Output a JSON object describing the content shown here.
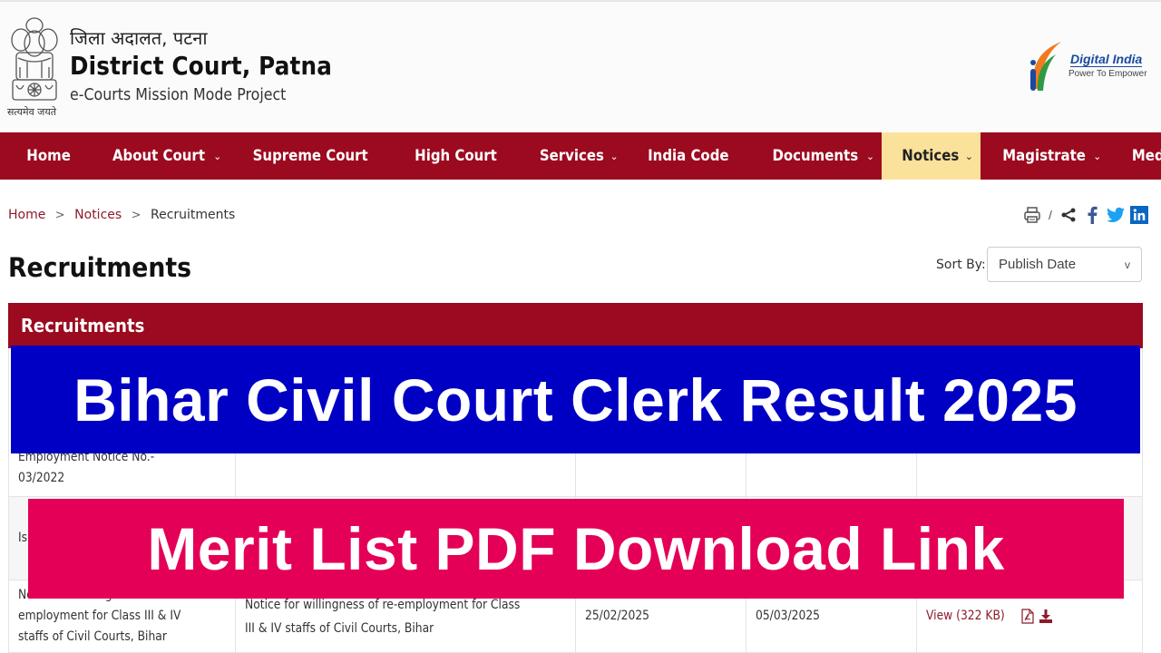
{
  "header": {
    "emblem_motto": "सत्यमेव जयते",
    "hindi_name": "जिला अदालत, पटना",
    "title": "District Court, Patna",
    "subtitle": "e-Courts Mission Mode Project",
    "digital_india": {
      "title": "Digital India",
      "tagline": "Power To Empower"
    }
  },
  "nav": {
    "items": [
      {
        "label": "Home",
        "dropdown": false
      },
      {
        "label": "About Court",
        "dropdown": true
      },
      {
        "label": "Supreme Court",
        "dropdown": false
      },
      {
        "label": "High Court",
        "dropdown": false
      },
      {
        "label": "Services",
        "dropdown": true
      },
      {
        "label": "India Code",
        "dropdown": false
      },
      {
        "label": "Documents",
        "dropdown": true
      },
      {
        "label": "Notices",
        "dropdown": true,
        "active": true
      },
      {
        "label": "Magistrate",
        "dropdown": true
      },
      {
        "label": "Media Gallery",
        "dropdown": true
      }
    ],
    "chevron": "⌄"
  },
  "breadcrumb": {
    "items": [
      "Home",
      "Notices",
      "Recruitments"
    ],
    "separator": ">"
  },
  "share": {
    "print_icon": "print-icon",
    "separator": "/",
    "icons": [
      "share-icon",
      "facebook-icon",
      "twitter-icon",
      "linkedin-icon"
    ]
  },
  "page_title": "Recruitments",
  "sort": {
    "label": "Sort By:",
    "selected": "Publish Date",
    "caret": "v"
  },
  "section": {
    "title": "Recruitments"
  },
  "table": {
    "rows": [
      {
        "title": "for interview in connection with Employment Notice No.- 03/2022",
        "description": "",
        "start_date": "",
        "end_date": "",
        "file": ""
      },
      {
        "title": "Is... th... Er...",
        "description": "",
        "start_date": "",
        "end_date": "",
        "file": ""
      },
      {
        "title": "Notice for willingness of re-employment for Class III & IV staffs of Civil Courts, Bihar",
        "description": "Notice for willingness of re-employment for Class III & IV staffs of Civil Courts, Bihar",
        "start_date": "25/02/2025",
        "end_date": "05/03/2025",
        "file": "View (322 KB)"
      }
    ]
  },
  "banners": {
    "top": "Bihar Civil Court Clerk Result 2025",
    "bottom": "Merit List PDF Download Link"
  },
  "colors": {
    "brand_maroon": "#9b0a1f",
    "nav_active": "#fbe29a",
    "banner_blue": "#0000c4",
    "banner_pink": "#e40057",
    "link": "#8d1a2b"
  }
}
